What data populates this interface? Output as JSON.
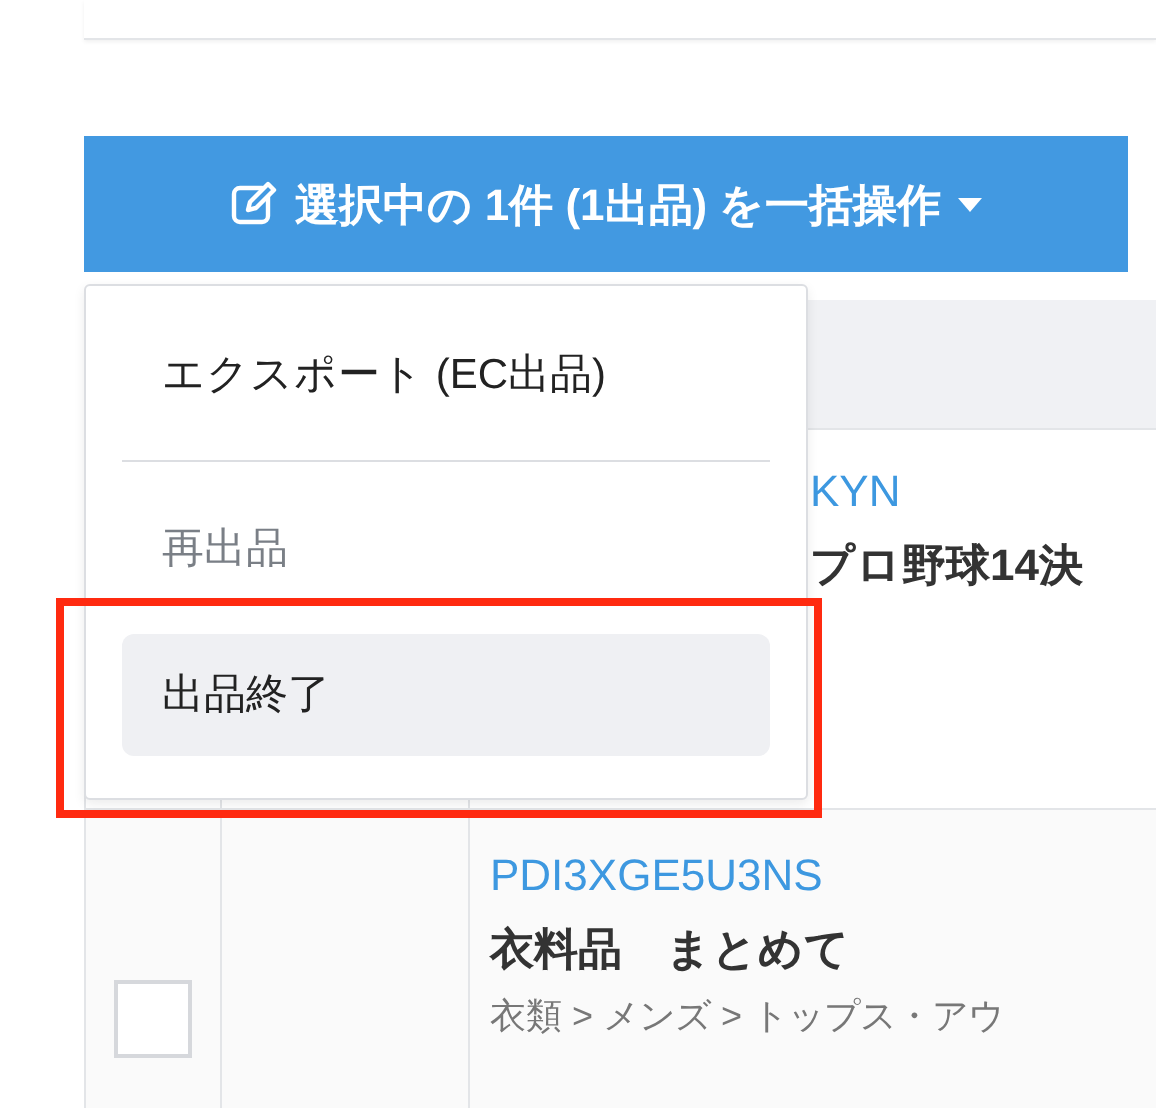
{
  "bulk_button": {
    "label": "選択中の 1件 (1出品) を一括操作"
  },
  "menu": {
    "items": [
      {
        "kind": "item",
        "label": "エクスポート (EC出品)",
        "disabled": false,
        "selected": false
      },
      {
        "kind": "divider"
      },
      {
        "kind": "item",
        "label": "再出品",
        "disabled": true,
        "selected": false
      },
      {
        "kind": "item",
        "label": "出品終了",
        "disabled": false,
        "selected": true
      }
    ]
  },
  "table": {
    "rows": [
      {
        "kind": "partial",
        "id_text": "KYN",
        "title": "プロ野球14決"
      },
      {
        "kind": "full",
        "id_text": "PDI3XGE5U3NS",
        "title": "衣料品　まとめて",
        "category": "衣類 > メンズ > トップス・アウ",
        "checked": false
      }
    ]
  }
}
